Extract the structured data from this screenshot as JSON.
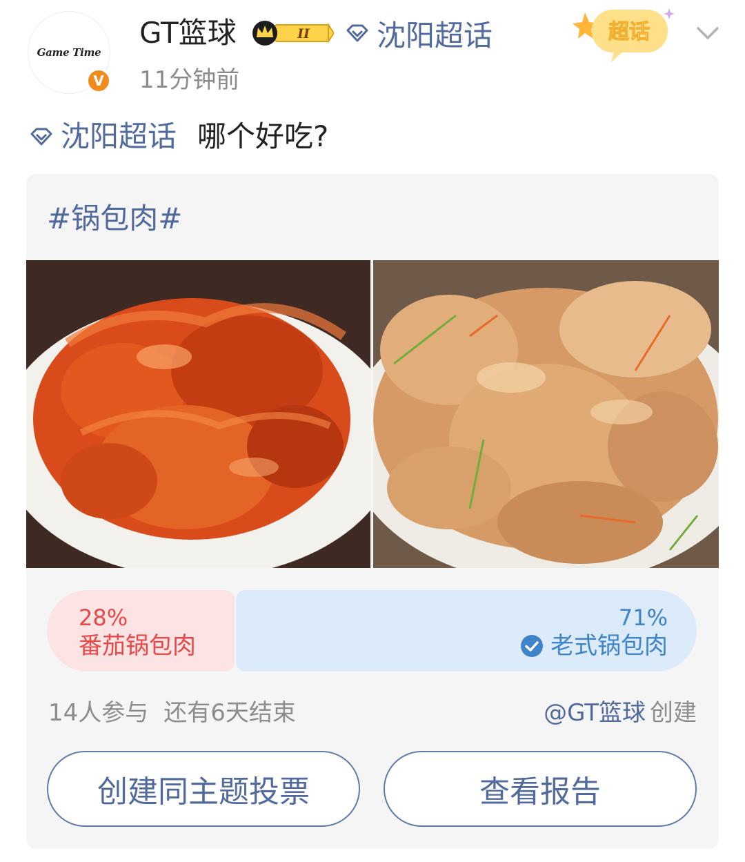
{
  "header": {
    "avatar_text": "Game Time",
    "verified_badge": "V",
    "username": "GT篮球",
    "rank_badge": "II",
    "topic_link": "沈阳超话",
    "timestamp": "11分钟前",
    "supertopic_sticker": "超话"
  },
  "post": {
    "topic": "沈阳超话",
    "text": "哪个好吃?"
  },
  "poll": {
    "title": "#锅包肉#",
    "options": [
      {
        "percent": "28%",
        "label": "番茄锅包肉",
        "share": 0.28,
        "color": "#e84848",
        "selected": false
      },
      {
        "percent": "71%",
        "label": "老式锅包肉",
        "share": 0.71,
        "color": "#3f83c9",
        "selected": true
      }
    ],
    "participants": "14人参与",
    "deadline": "还有6天结束",
    "creator": "@GT篮球",
    "creator_suffix": "创建",
    "buttons": {
      "create": "创建同主题投票",
      "report": "查看报告"
    }
  },
  "colors": {
    "link": "#506a9e",
    "left_option": "#e84848",
    "right_option": "#3f83c9",
    "left_bar_bg": "#fde4e4",
    "right_bar_bg": "#dcebfa"
  }
}
